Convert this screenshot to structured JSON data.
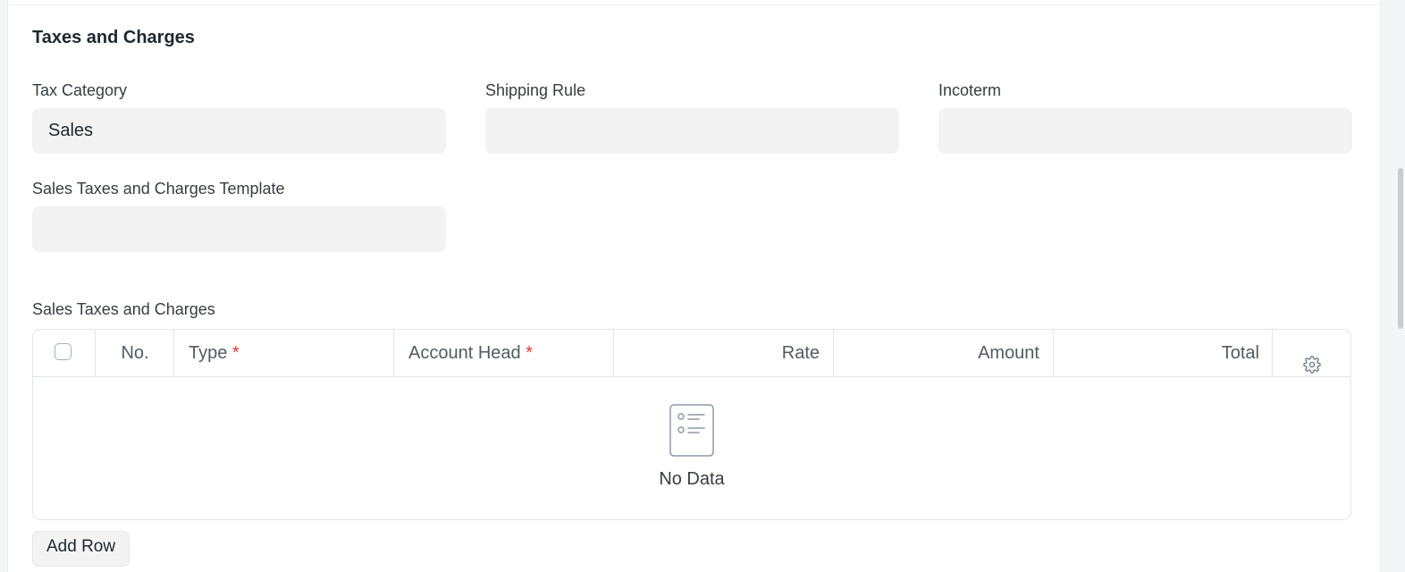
{
  "section": {
    "title": "Taxes and Charges"
  },
  "fields": {
    "tax_category": {
      "label": "Tax Category",
      "value": "Sales"
    },
    "shipping_rule": {
      "label": "Shipping Rule",
      "value": ""
    },
    "incoterm": {
      "label": "Incoterm",
      "value": ""
    },
    "taxes_template": {
      "label": "Sales Taxes and Charges Template",
      "value": ""
    }
  },
  "table": {
    "label": "Sales Taxes and Charges",
    "columns": {
      "no": "No.",
      "type": "Type",
      "account_head": "Account Head",
      "rate": "Rate",
      "amount": "Amount",
      "total": "Total"
    },
    "required_marker": "*",
    "empty_text": "No Data",
    "add_row_label": "Add Row"
  },
  "icons": {
    "settings": "gear-icon",
    "empty_state": "list-document-icon"
  },
  "colors": {
    "required": "#e03636",
    "input_bg": "#f3f3f4",
    "border": "#e2e6e9"
  }
}
